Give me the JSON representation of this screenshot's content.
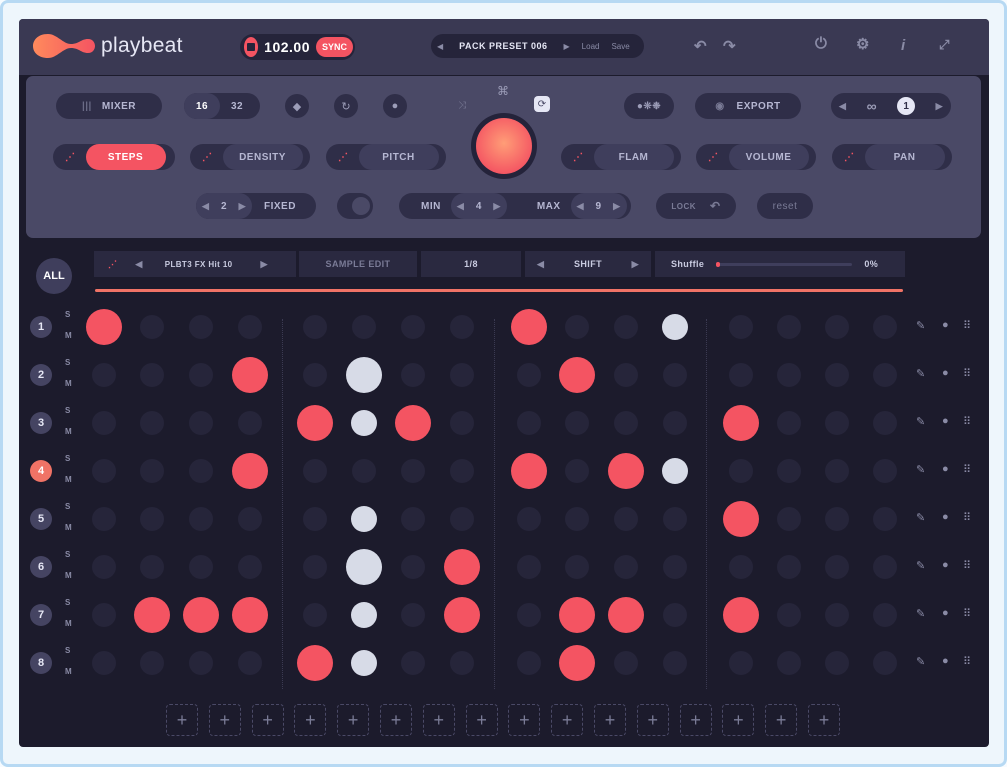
{
  "app": {
    "name": "playbeat"
  },
  "transport": {
    "bpm": "102.00",
    "sync_label": "SYNC"
  },
  "preset": {
    "name": "PACK PRESET 006",
    "load_label": "Load",
    "save_label": "Save"
  },
  "top_icons": [
    "undo-icon",
    "redo-icon",
    "power-icon",
    "gear-icon",
    "info-icon",
    "expand-icon"
  ],
  "panel": {
    "mixer_label": "MIXER",
    "steps_option_a": "16",
    "steps_option_b": "32",
    "export_label": "EXPORT",
    "loop_count": "1",
    "params": [
      "STEPS",
      "DENSITY",
      "PITCH",
      "FLAM",
      "VOLUME",
      "PAN"
    ],
    "fixed_value": "2",
    "fixed_label": "FIXED",
    "min_label": "MIN",
    "min_value": "4",
    "max_label": "MAX",
    "max_value": "9",
    "lock_label": "LOCK",
    "reset_label": "reset"
  },
  "sequencer": {
    "all_label": "ALL",
    "sample_name": "PLBT3 FX Hit 10",
    "sample_edit_label": "SAMPLE EDIT",
    "division": "1/8",
    "shift_label": "SHIFT",
    "shuffle_label": "Shuffle",
    "shuffle_value": "0%",
    "solo_label": "S",
    "mute_label": "M",
    "active_row": 4,
    "rows": [
      {
        "number": "1",
        "steps": [
          "R",
          ".",
          ".",
          ".",
          ".",
          ".",
          ".",
          ".",
          "R",
          ".",
          ".",
          "ws",
          ".",
          ".",
          ".",
          "."
        ]
      },
      {
        "number": "2",
        "steps": [
          ".",
          ".",
          ".",
          "R",
          ".",
          "wl",
          ".",
          ".",
          ".",
          "R",
          ".",
          ".",
          ".",
          ".",
          ".",
          "."
        ]
      },
      {
        "number": "3",
        "steps": [
          ".",
          ".",
          ".",
          ".",
          "R",
          "ws",
          "R",
          ".",
          ".",
          ".",
          ".",
          ".",
          "R",
          ".",
          ".",
          "."
        ]
      },
      {
        "number": "4",
        "steps": [
          ".",
          ".",
          ".",
          "R",
          ".",
          ".",
          ".",
          ".",
          "R",
          ".",
          "R",
          "ws",
          ".",
          ".",
          ".",
          "."
        ]
      },
      {
        "number": "5",
        "steps": [
          ".",
          ".",
          ".",
          ".",
          ".",
          "ws",
          ".",
          ".",
          ".",
          ".",
          ".",
          ".",
          "R",
          ".",
          ".",
          "."
        ]
      },
      {
        "number": "6",
        "steps": [
          ".",
          ".",
          ".",
          ".",
          ".",
          "wl",
          ".",
          "R",
          ".",
          ".",
          ".",
          ".",
          ".",
          ".",
          ".",
          "."
        ]
      },
      {
        "number": "7",
        "steps": [
          ".",
          "R",
          "R",
          "R",
          ".",
          "ws",
          ".",
          "R",
          ".",
          "R",
          "R",
          ".",
          "R",
          ".",
          ".",
          "."
        ]
      },
      {
        "number": "8",
        "steps": [
          ".",
          ".",
          ".",
          ".",
          "R",
          "ws",
          ".",
          ".",
          ".",
          "R",
          ".",
          ".",
          ".",
          ".",
          ".",
          "."
        ]
      }
    ],
    "add_slots": 16
  },
  "colors": {
    "accent": "#f45462",
    "background": "#1c1b2c",
    "panel": "#4a4966"
  }
}
